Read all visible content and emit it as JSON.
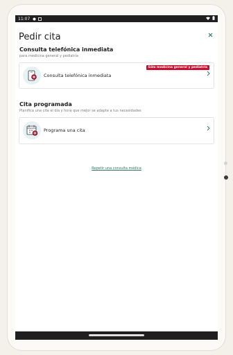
{
  "status": {
    "time": "11:07"
  },
  "header": {
    "title": "Pedir cita",
    "close_icon": "close-icon"
  },
  "immediate": {
    "section_title": "Consulta telefónica inmediata",
    "section_subtitle": "para medicina general y pediatría",
    "card_label": "Consulta telefónica inmediata",
    "badge": "Sólo medicina general y pediatría"
  },
  "scheduled": {
    "section_title": "Cita programada",
    "section_subtitle": "Planifica una cita el día y hora que mejor se adapte a tus necesidades",
    "card_label": "Programa una cita"
  },
  "repeat_link": "Repetir una consulta médica",
  "colors": {
    "accent": "#2a7a5b",
    "badge": "#c8102e",
    "icon_bg": "#e6f1f6"
  }
}
